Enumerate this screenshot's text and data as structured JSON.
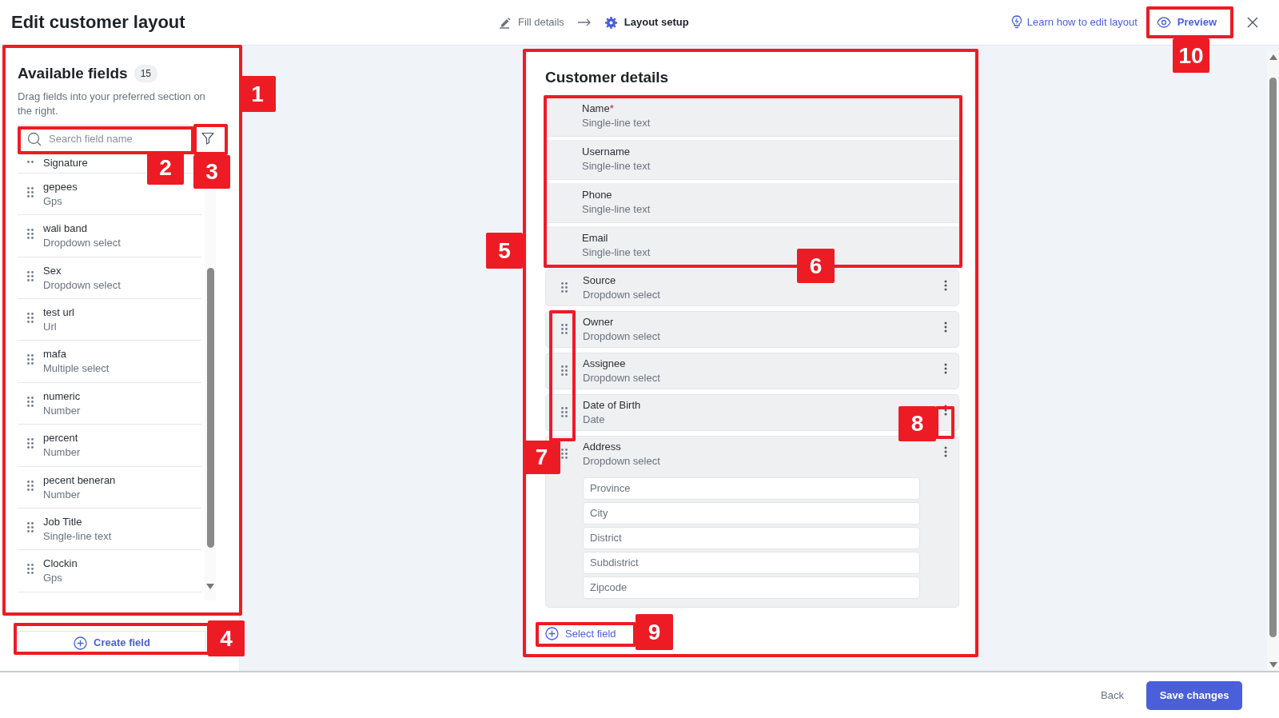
{
  "header": {
    "title": "Edit customer layout",
    "steps": [
      {
        "label": "Fill details",
        "selected": false
      },
      {
        "label": "Layout setup",
        "selected": true
      }
    ],
    "help_link": "Learn how to edit layout",
    "preview_button": "Preview"
  },
  "available_fields": {
    "title": "Available fields",
    "count": "15",
    "description": "Drag fields into your preferred section on the right.",
    "search": {
      "placeholder": "Search field name"
    },
    "items": [
      {
        "name": "Signature"
      },
      {
        "name": "gepees",
        "type": "Gps"
      },
      {
        "name": "wali band",
        "type": "Dropdown select"
      },
      {
        "name": "Sex",
        "type": "Dropdown select"
      },
      {
        "name": "test url",
        "type": "Url"
      },
      {
        "name": "mafa",
        "type": "Multiple select"
      },
      {
        "name": "numeric",
        "type": "Number"
      },
      {
        "name": "percent",
        "type": "Number"
      },
      {
        "name": "pecent beneran",
        "type": "Number"
      },
      {
        "name": "Job Title",
        "type": "Single-line text"
      },
      {
        "name": "Clockin",
        "type": "Gps"
      }
    ],
    "create_button": "Create field"
  },
  "section": {
    "title": "Customer details",
    "fields": [
      {
        "kind": "fixed",
        "name": "Name",
        "required_mark": "*",
        "type": "Single-line text"
      },
      {
        "kind": "fixed",
        "name": "Username",
        "type": "Single-line text"
      },
      {
        "kind": "fixed",
        "name": "Phone",
        "type": "Single-line text"
      },
      {
        "kind": "fixed",
        "name": "Email",
        "type": "Single-line text"
      },
      {
        "kind": "movable",
        "name": "Source",
        "type": "Dropdown select"
      },
      {
        "kind": "movable",
        "name": "Owner",
        "type": "Dropdown select"
      },
      {
        "kind": "movable",
        "name": "Assignee",
        "type": "Dropdown select"
      },
      {
        "kind": "movable",
        "name": "Date of Birth",
        "type": "Date"
      },
      {
        "kind": "group",
        "name": "Address",
        "type": "Dropdown select",
        "subfields": [
          {
            "placeholder": "Province"
          },
          {
            "placeholder": "City"
          },
          {
            "placeholder": "District"
          },
          {
            "placeholder": "Subdistrict"
          },
          {
            "placeholder": "Zipcode"
          }
        ]
      }
    ],
    "select_button": "Select field"
  },
  "footer": {
    "back_button": "Back",
    "save_button": "Save changes"
  },
  "annotations": [
    {
      "number": "1"
    },
    {
      "number": "2"
    },
    {
      "number": "3"
    },
    {
      "number": "4"
    },
    {
      "number": "5"
    },
    {
      "number": "6"
    },
    {
      "number": "7"
    },
    {
      "number": "8"
    },
    {
      "number": "9"
    },
    {
      "number": "10"
    }
  ]
}
